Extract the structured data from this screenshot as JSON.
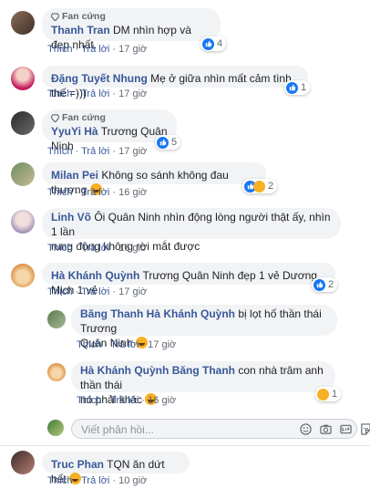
{
  "actions": {
    "like": "Thích",
    "reply": "Trả lời",
    "sep": "·"
  },
  "badge": "Fan cứng",
  "comments": [
    {
      "name": "Thanh Tran",
      "text": "DM nhìn hợp và đẹp nhất.",
      "fan": true,
      "time": "17 giờ",
      "reaction_count": "4",
      "reaction": "like"
    },
    {
      "name": "Đặng Tuyết Nhung",
      "text": "Mẹ ở giữa nhìn mất cảm tình thế =)))",
      "fan": false,
      "time": "17 giờ",
      "reaction_count": "1",
      "reaction": "like"
    },
    {
      "name": "YyuYi Hà",
      "text": "Trương Quân Ninh",
      "fan": true,
      "time": "17 giờ",
      "reaction_count": "5",
      "reaction": "like"
    },
    {
      "name": "Milan Pei",
      "text": "Không so sánh không đau thương",
      "fan": false,
      "time": "16 giờ",
      "reaction_count": "2",
      "reaction": "like-haha"
    },
    {
      "name": "Linh Võ",
      "text_line1": "Ôi Quân Ninh nhìn động lòng người thật ấy, nhìn 1 lần",
      "text_line2": "rung động không rời mắt được",
      "fan": false,
      "time": "16 giờ"
    },
    {
      "name": "Hà Khánh Quỳnh",
      "text": "Trương Quân Ninh đẹp 1 vẻ Dương Mịch 1 vẻ",
      "fan": false,
      "time": "17 giờ",
      "reaction_count": "2",
      "reaction": "like"
    }
  ],
  "replies": [
    {
      "name": "Băng Thanh",
      "mention": "Hà Khánh Quỳnh",
      "text_line1": "bị lọt hố thần thái Trương",
      "text_line2": "Quân Ninh",
      "time": "17 giờ"
    },
    {
      "name": "Hà Khánh Quỳnh",
      "mention": "Băng Thanh",
      "text_line1": "con nhà trâm anh thần thái",
      "text_line2": "nó phải khác",
      "time": "16 giờ",
      "reaction_count": "1",
      "reaction": "haha"
    }
  ],
  "reply_input": {
    "placeholder": "Viết phản hồi..."
  },
  "last_comment": {
    "name": "Truc Phan",
    "text": "TQN ăn dứt hết",
    "time": "10 giờ"
  }
}
